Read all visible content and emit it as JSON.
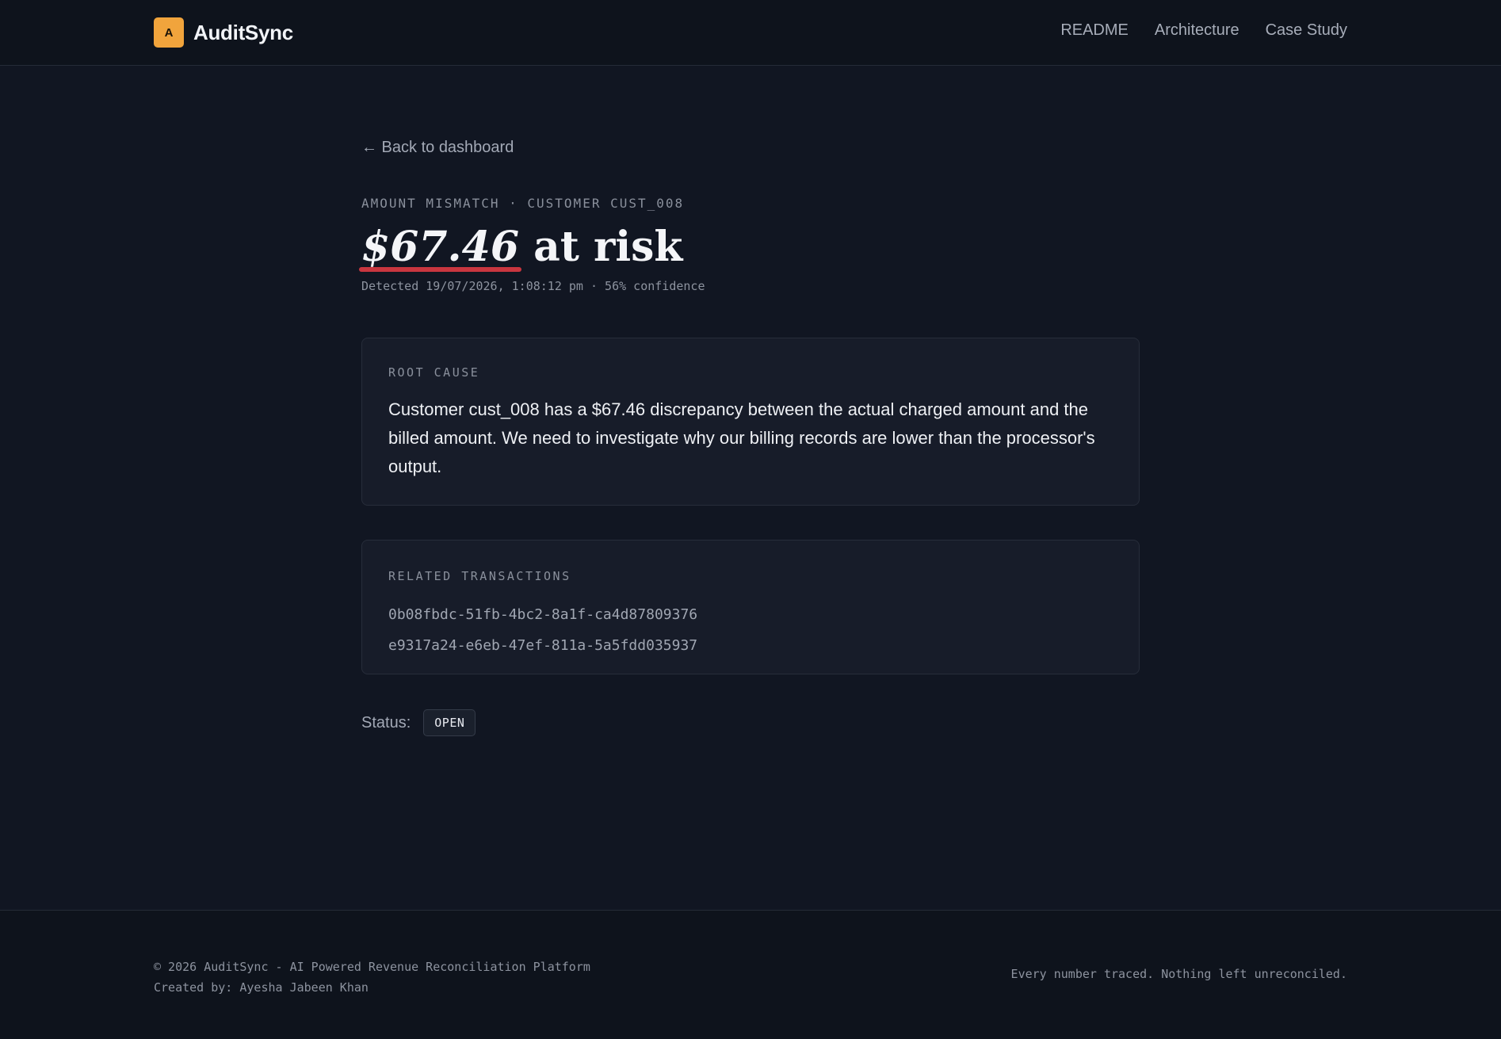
{
  "header": {
    "logo_letter": "A",
    "brand": "AuditSync",
    "nav": [
      {
        "label": "README"
      },
      {
        "label": "Architecture"
      },
      {
        "label": "Case Study"
      }
    ]
  },
  "main": {
    "back_link": "← Back to dashboard",
    "kicker": "AMOUNT MISMATCH · CUSTOMER CUST_008",
    "amount": "$67.46",
    "headline_suffix": "at risk",
    "detected": "Detected 19/07/2026, 1:08:12 pm · 56% confidence",
    "root_cause": {
      "label": "ROOT CAUSE",
      "text": "Customer cust_008 has a $67.46 discrepancy between the actual charged amount and the billed amount. We need to investigate why our billing records are lower than the processor's output."
    },
    "related": {
      "label": "RELATED TRANSACTIONS",
      "items": [
        "0b08fbdc-51fb-4bc2-8a1f-ca4d87809376",
        "e9317a24-e6eb-47ef-811a-5a5fdd035937"
      ]
    },
    "status": {
      "label": "Status:",
      "value": "OPEN"
    }
  },
  "footer": {
    "copyright": "© 2026 AuditSync - AI Powered Revenue Reconciliation Platform",
    "credit": "Created by: Ayesha Jabeen Khan",
    "tagline": "Every number traced. Nothing left unreconciled."
  },
  "colors": {
    "background": "#111622",
    "accent": "#f1a43c",
    "underline": "#c9363f"
  }
}
